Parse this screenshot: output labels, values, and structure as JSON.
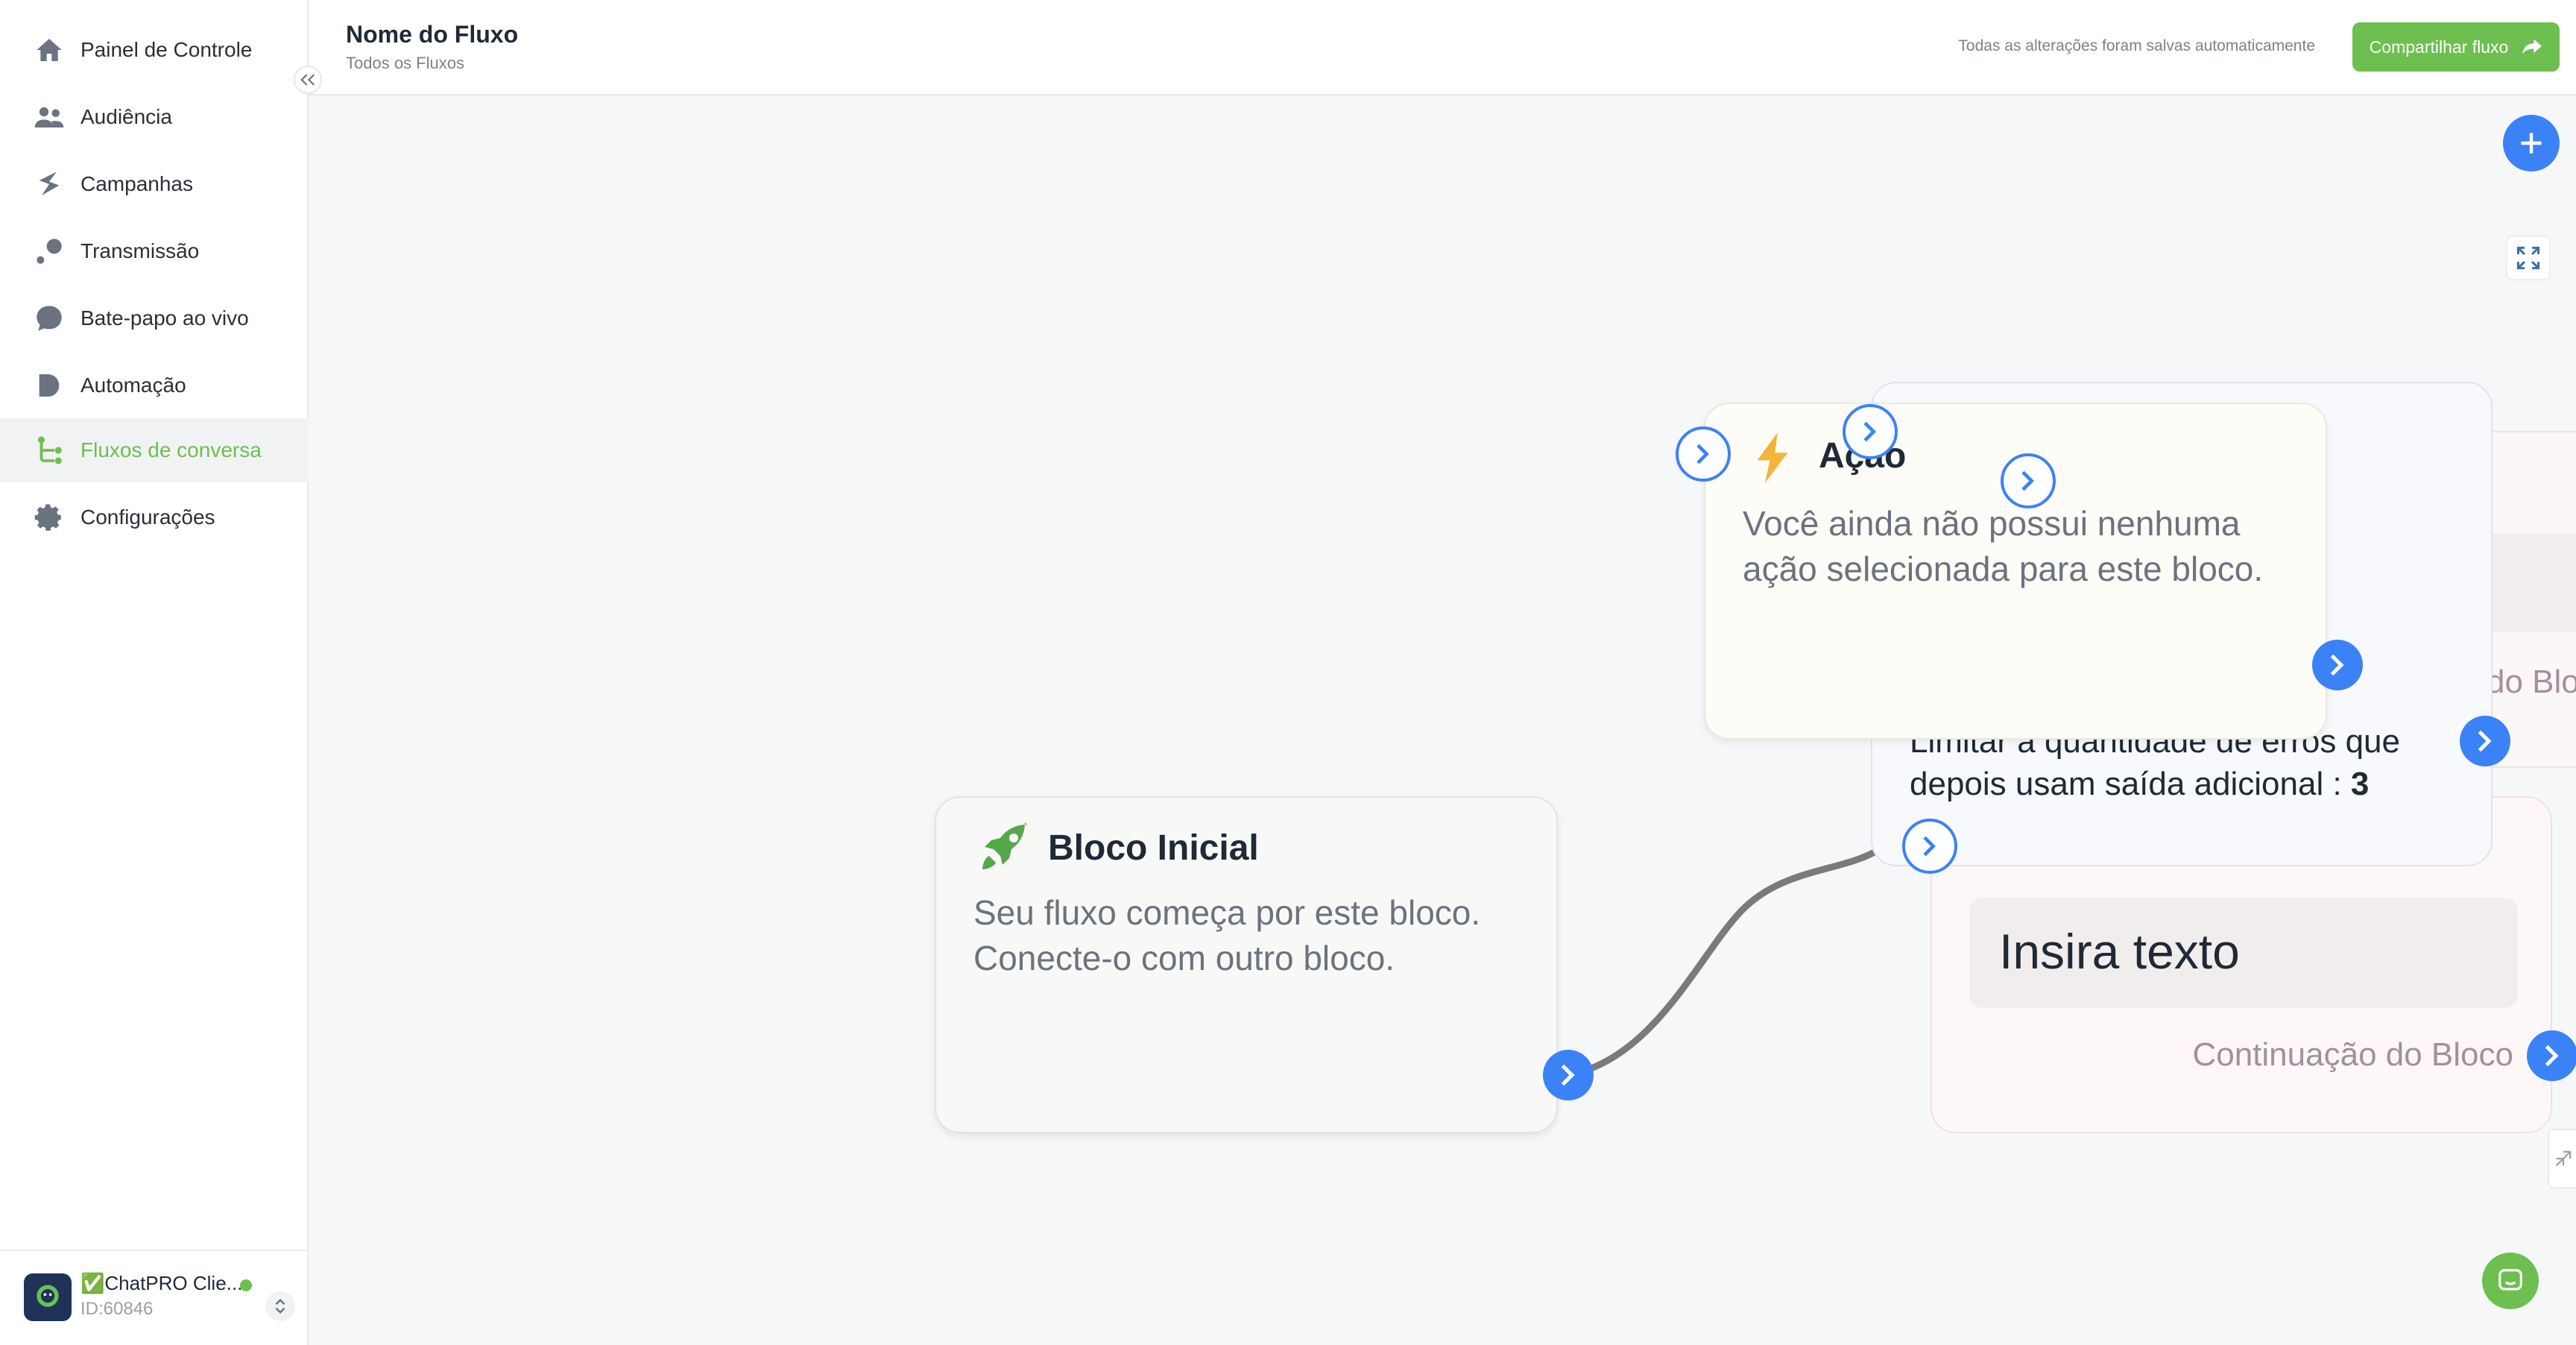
{
  "sidebar": {
    "items": [
      {
        "label": "Painel de Controle",
        "icon": "home-icon"
      },
      {
        "label": "Audiência",
        "icon": "users-icon"
      },
      {
        "label": "Campanhas",
        "icon": "campaign-icon"
      },
      {
        "label": "Transmissão",
        "icon": "broadcast-icon"
      },
      {
        "label": "Bate-papo ao vivo",
        "icon": "chat-bubble-icon"
      },
      {
        "label": "Automação",
        "icon": "automation-icon"
      },
      {
        "label": "Fluxos de conversa",
        "icon": "flow-icon",
        "active": true
      },
      {
        "label": "Configurações",
        "icon": "gear-icon"
      }
    ],
    "account": {
      "name": "✅ChatPRO Clie...",
      "id": "ID:60846",
      "status_color": "#6dbf4f"
    }
  },
  "header": {
    "title": "Nome do Fluxo",
    "breadcrumb": "Todos os Fluxos",
    "autosave": "Todas as alterações foram salvas automaticamente",
    "share_label": "Compartilhar fluxo"
  },
  "canvas": {
    "start_block": {
      "title": "Bloco Inicial",
      "text": "Seu fluxo começa por este bloco. Conecte-o com outro bloco."
    },
    "action_block": {
      "title": "Ação",
      "text": "Você ainda não possui nenhuma ação selecionada para este bloco."
    },
    "limit_block": {
      "text": "Limitar a quantidade de erros que depois usam saída adicional : ",
      "value": "3"
    },
    "text_block": {
      "input_text": "Insira texto",
      "continuation": "Continuação do Bloco"
    },
    "right_block": {
      "continuation_partial": "do Blo"
    }
  },
  "colors": {
    "accent_green": "#6dbf4f",
    "accent_blue": "#3b82f6"
  }
}
